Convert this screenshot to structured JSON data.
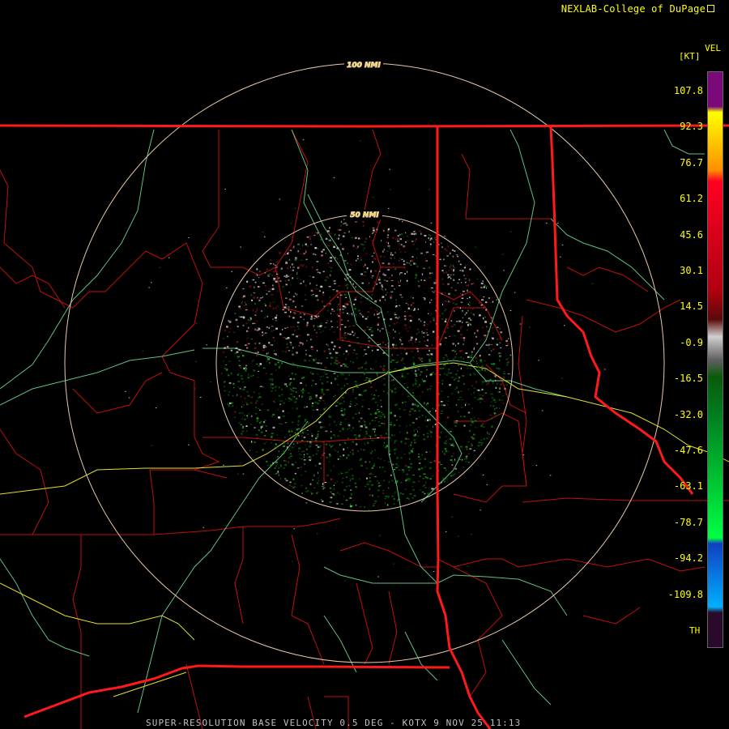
{
  "header": {
    "credit": "NEXLAB-College of DuPage",
    "product_code": "VEL",
    "unit": "[KT]"
  },
  "legend": {
    "ticks": [
      "107.8",
      "92.3",
      "76.7",
      "61.2",
      "45.6",
      "30.1",
      "14.5",
      "-0.9",
      "-16.5",
      "-32.0",
      "-47.6",
      "-63.1",
      "-78.7",
      "-94.2",
      "-109.8"
    ],
    "range_folded_label": "TH",
    "colors": {
      "top": "#7a0a7a",
      "yellow": "#ffff00",
      "red": "#ff0022",
      "dark_red": "#5a0a0a",
      "gray": "#d0d0d0",
      "dark_green": "#0a5a0a",
      "green": "#00ff44",
      "blue": "#1040c0",
      "cyan": "#00b0ff",
      "range_folded": "#2a0a2a"
    }
  },
  "range_rings": {
    "outer_label": "100 NMI",
    "inner_label": "50 NMI"
  },
  "map_colors": {
    "state_border": "#ff1a1a",
    "county_line": "#c01010",
    "river": "#60c080",
    "highway": "#e0e030",
    "ring": "#e8c8a8"
  },
  "footer": {
    "caption": "SUPER-RESOLUTION BASE VELOCITY 0.5 DEG - KOTX 9 NOV 25 11:13"
  }
}
